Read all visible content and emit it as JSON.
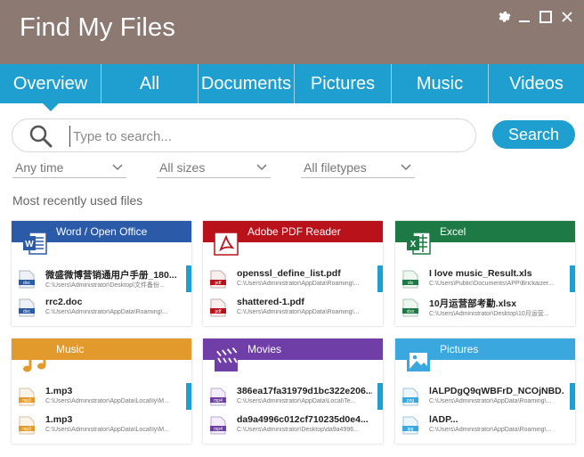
{
  "app": {
    "title": "Find My Files"
  },
  "tabs": [
    {
      "label": "Overview",
      "active": true
    },
    {
      "label": "All"
    },
    {
      "label": "Documents"
    },
    {
      "label": "Pictures"
    },
    {
      "label": "Music"
    },
    {
      "label": "Videos"
    }
  ],
  "search": {
    "placeholder": "Type to search...",
    "button_label": "Search"
  },
  "filters": {
    "time": "Any time",
    "size": "All sizes",
    "type": "All filetypes"
  },
  "section_title": "Most recently used files",
  "colors": {
    "title_bar": "#8c7a72",
    "accent": "#1f9fd0",
    "word": "#2b5aa8",
    "pdf": "#b9121b",
    "excel": "#1e7a45",
    "music": "#e39a2c",
    "movies": "#6f3fa7",
    "pictures": "#3aa7de"
  },
  "cards": {
    "word": {
      "title": "Word / Open Office",
      "files": [
        {
          "name": "微盛微博营销通用户手册_180...",
          "path": "C:\\Users\\Administrator\\Desktop\\文件备份...",
          "ext": "doc"
        },
        {
          "name": "rrc2.doc",
          "path": "C:\\Users\\Administrator\\AppData\\Roaming\\...",
          "ext": "doc"
        }
      ]
    },
    "pdf": {
      "title": "Adobe PDF Reader",
      "files": [
        {
          "name": "openssl_define_list.pdf",
          "path": "C:\\Users\\Administrator\\AppData\\Roaming\\...",
          "ext": "pdf"
        },
        {
          "name": "shattered-1.pdf",
          "path": "C:\\Users\\Administrator\\AppData\\Roaming\\...",
          "ext": "pdf"
        }
      ]
    },
    "excel": {
      "title": "Excel",
      "files": [
        {
          "name": "I love music_Result.xls",
          "path": "C:\\Users\\Public\\Documents\\APP\\Brickaizer...",
          "ext": "xls"
        },
        {
          "name": "10月运营部考勤.xlsx",
          "path": "C:\\Users\\Administrator\\Desktop\\10月运营...",
          "ext": "xlsx"
        }
      ]
    },
    "music": {
      "title": "Music",
      "files": [
        {
          "name": "1.mp3",
          "path": "C:\\Users\\Administrator\\AppData\\Local\\ly\\M...",
          "ext": "mp3"
        },
        {
          "name": "1.mp3",
          "path": "C:\\Users\\Administrator\\AppData\\Local\\ly\\M...",
          "ext": "mp3"
        }
      ]
    },
    "movies": {
      "title": "Movies",
      "files": [
        {
          "name": "386ea17fa31979d1bc322e206...",
          "path": "C:\\Users\\Administrator\\AppData\\Local\\Te...",
          "ext": "mp4"
        },
        {
          "name": "da9a4996c012cf710235d0e4...",
          "path": "C:\\Users\\Administrator\\Desktop\\da9a4996...",
          "ext": "mp4"
        }
      ]
    },
    "pictures": {
      "title": "Pictures",
      "files": [
        {
          "name": "lALPDgQ9qWBFrD_NCOjNBD...",
          "path": "C:\\Users\\Administrator\\AppData\\Roaming\\...",
          "ext": "png"
        },
        {
          "name": "lADP...",
          "path": "C:\\Users\\Administrator\\AppData\\Roaming\\...",
          "ext": "jpg"
        }
      ]
    }
  }
}
